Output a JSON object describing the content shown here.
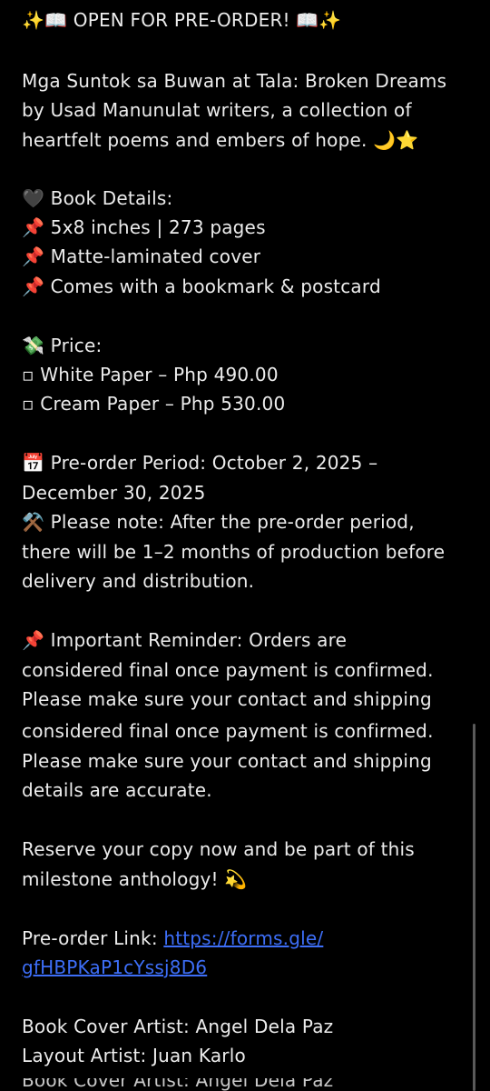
{
  "post": {
    "l1": "✨📖 OPEN FOR PRE-ORDER! 📖✨",
    "l2": "Mga Suntok sa Buwan at Tala: Broken Dreams",
    "l3": "by Usad Manunulat writers, a collection of",
    "l4": "heartfelt poems and embers of hope. 🌙⭐",
    "l5": "🖤 Book Details:",
    "l6": "📌 5x8 inches | 273 pages",
    "l7": "📌 Matte-laminated cover",
    "l8": "📌 Comes with a bookmark & postcard",
    "l9": "💸 Price:",
    "l10": "▫ White Paper – Php 490.00",
    "l11": "▫ Cream Paper – Php 530.00",
    "l12": "📅 Pre-order Period: October 2, 2025 –",
    "l13": "December 30, 2025",
    "l14": "⚒️ Please note: After the pre-order period,",
    "l15": "there will be 1–2 months of production before",
    "l16": "delivery and distribution.",
    "l17": "📌 Important Reminder: Orders are",
    "l18": "considered final once payment is confirmed.",
    "l19": "Please make sure your contact and shipping",
    "l20": "considered final once payment is confirmed.",
    "l21": "Please make sure your contact and shipping",
    "l22": "details are accurate.",
    "l23": "Reserve your copy now and be part of this",
    "l24": "milestone anthology! 💫",
    "link_label": "Pre-order Link: ",
    "link_1": "https://forms.gle/",
    "link_2": "gfHBPKaP1cYssj8D6",
    "l27": " Book Cover Artist: Angel Dela Paz",
    "l28": " Layout Artist: Juan Karlo",
    "l29": " Book Cover Artist: Angel Dela Paz"
  }
}
